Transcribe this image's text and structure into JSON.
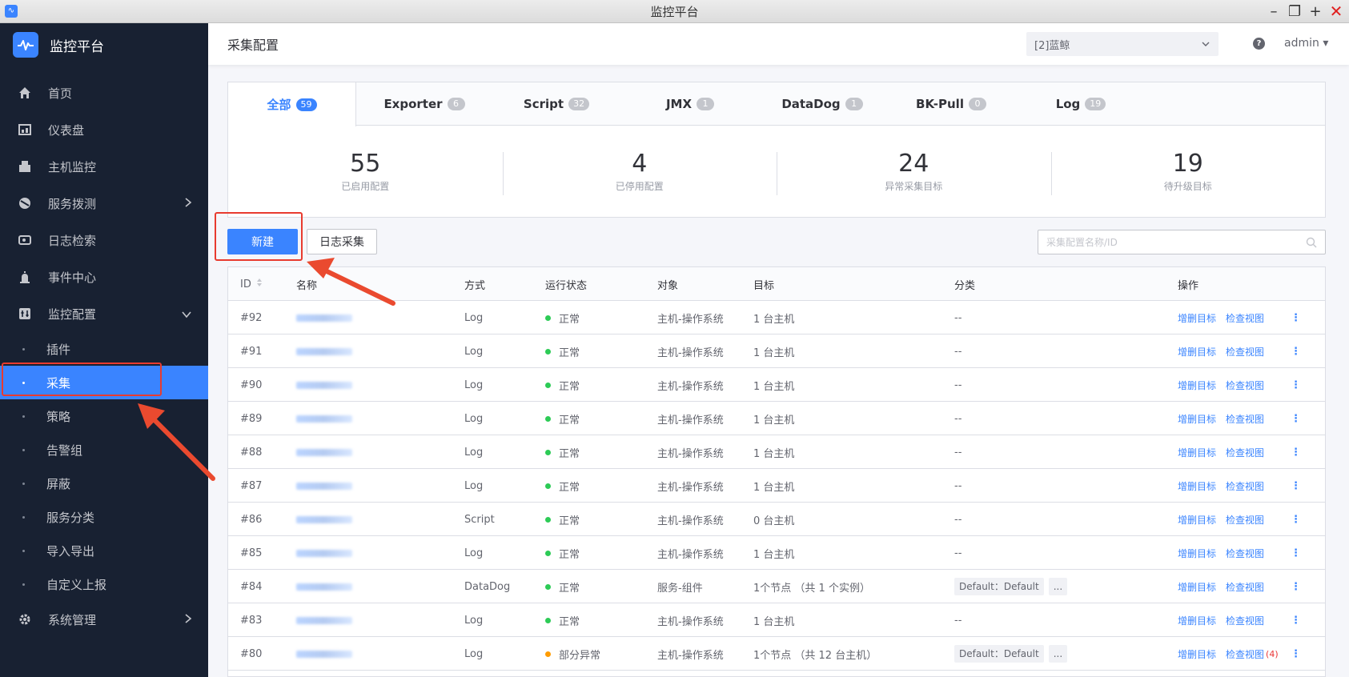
{
  "window": {
    "title": "监控平台"
  },
  "sidebar": {
    "brand": "监控平台",
    "items": [
      {
        "label": "首页",
        "icon": "home-icon"
      },
      {
        "label": "仪表盘",
        "icon": "dashboard-icon"
      },
      {
        "label": "主机监控",
        "icon": "building-icon"
      },
      {
        "label": "服务拨测",
        "icon": "probe-icon"
      },
      {
        "label": "日志检索",
        "icon": "log-search-icon"
      },
      {
        "label": "事件中心",
        "icon": "alarm-icon"
      },
      {
        "label": "监控配置",
        "icon": "config-icon"
      }
    ],
    "sub_items": [
      "插件",
      "采集",
      "策略",
      "告警组",
      "屏蔽",
      "服务分类",
      "导入导出",
      "自定义上报"
    ],
    "active_sub": "采集",
    "bottom": {
      "label": "系统管理",
      "icon": "gear-icon"
    }
  },
  "header": {
    "title": "采集配置",
    "business_select": "[2]蓝鲸",
    "user": "admin"
  },
  "tabs": [
    {
      "label": "全部",
      "count": "59",
      "active": true
    },
    {
      "label": "Exporter",
      "count": "6"
    },
    {
      "label": "Script",
      "count": "32"
    },
    {
      "label": "JMX",
      "count": "1"
    },
    {
      "label": "DataDog",
      "count": "1"
    },
    {
      "label": "BK-Pull",
      "count": "0"
    },
    {
      "label": "Log",
      "count": "19"
    }
  ],
  "stats": [
    {
      "value": "55",
      "label": "已启用配置"
    },
    {
      "value": "4",
      "label": "已停用配置"
    },
    {
      "value": "24",
      "label": "异常采集目标"
    },
    {
      "value": "19",
      "label": "待升级目标"
    }
  ],
  "toolbar": {
    "new_label": "新建",
    "log_label": "日志采集",
    "search_placeholder": "采集配置名称/ID"
  },
  "table": {
    "columns": {
      "id": "ID",
      "name": "名称",
      "method": "方式",
      "status": "运行状态",
      "object": "对象",
      "target": "目标",
      "category": "分类",
      "ops": "操作"
    },
    "op_labels": {
      "add_target": "增删目标",
      "view": "检查视图"
    },
    "status_colors": {
      "正常": "#2dcb56",
      "部分异常": "#ff9c01"
    },
    "rows": [
      {
        "id": "#92",
        "method": "Log",
        "status": "正常",
        "object": "主机-操作系统",
        "target": "1 台主机",
        "category": "--"
      },
      {
        "id": "#91",
        "method": "Log",
        "status": "正常",
        "object": "主机-操作系统",
        "target": "1 台主机",
        "category": "--"
      },
      {
        "id": "#90",
        "method": "Log",
        "status": "正常",
        "object": "主机-操作系统",
        "target": "1 台主机",
        "category": "--"
      },
      {
        "id": "#89",
        "method": "Log",
        "status": "正常",
        "object": "主机-操作系统",
        "target": "1 台主机",
        "category": "--"
      },
      {
        "id": "#88",
        "method": "Log",
        "status": "正常",
        "object": "主机-操作系统",
        "target": "1 台主机",
        "category": "--"
      },
      {
        "id": "#87",
        "method": "Log",
        "status": "正常",
        "object": "主机-操作系统",
        "target": "1 台主机",
        "category": "--"
      },
      {
        "id": "#86",
        "method": "Script",
        "status": "正常",
        "object": "主机-操作系统",
        "target": "0 台主机",
        "category": "--"
      },
      {
        "id": "#85",
        "method": "Log",
        "status": "正常",
        "object": "主机-操作系统",
        "target": "1 台主机",
        "category": "--"
      },
      {
        "id": "#84",
        "method": "DataDog",
        "status": "正常",
        "object": "服务-组件",
        "target": "1个节点 （共 1 个实例）",
        "category": "Default：Default",
        "more": "..."
      },
      {
        "id": "#83",
        "method": "Log",
        "status": "正常",
        "object": "主机-操作系统",
        "target": "1 台主机",
        "category": "--"
      },
      {
        "id": "#80",
        "method": "Log",
        "status": "部分异常",
        "object": "主机-操作系统",
        "target": "1个节点 （共 12 台主机）",
        "category": "Default：Default",
        "more": "...",
        "view_errors": "(4)"
      }
    ]
  }
}
